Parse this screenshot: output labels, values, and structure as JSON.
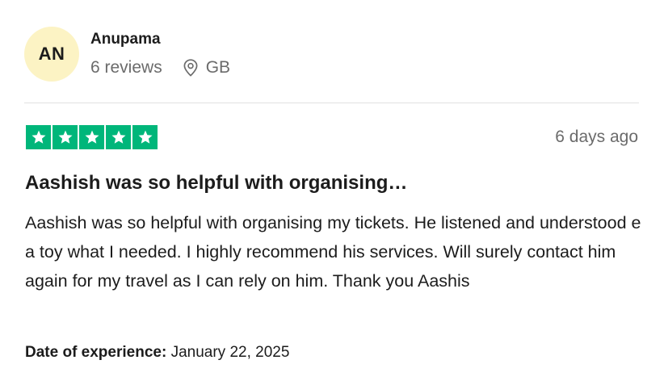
{
  "reviewer": {
    "initials": "AN",
    "name": "Anupama",
    "reviews_count": "6 reviews",
    "country": "GB"
  },
  "review": {
    "rating": 5,
    "max_rating": 5,
    "time_ago": "6 days ago",
    "title": "Aashish was so helpful with organising…",
    "body": "Aashish was so helpful with organising my tickets. He listened and understood e a toy what I needed. I highly recommend his services. Will surely contact him again for my travel as I can rely on him. Thank you Aashis",
    "experience_label": "Date of experience:",
    "experience_date": "January 22, 2025"
  },
  "colors": {
    "star_fill": "#00b67a",
    "avatar_bg": "#fcf3c4",
    "muted_text": "#6b6b6b",
    "divider": "#e1e1e1"
  },
  "icons": {
    "location": "location-pin-icon",
    "star": "star-icon"
  }
}
